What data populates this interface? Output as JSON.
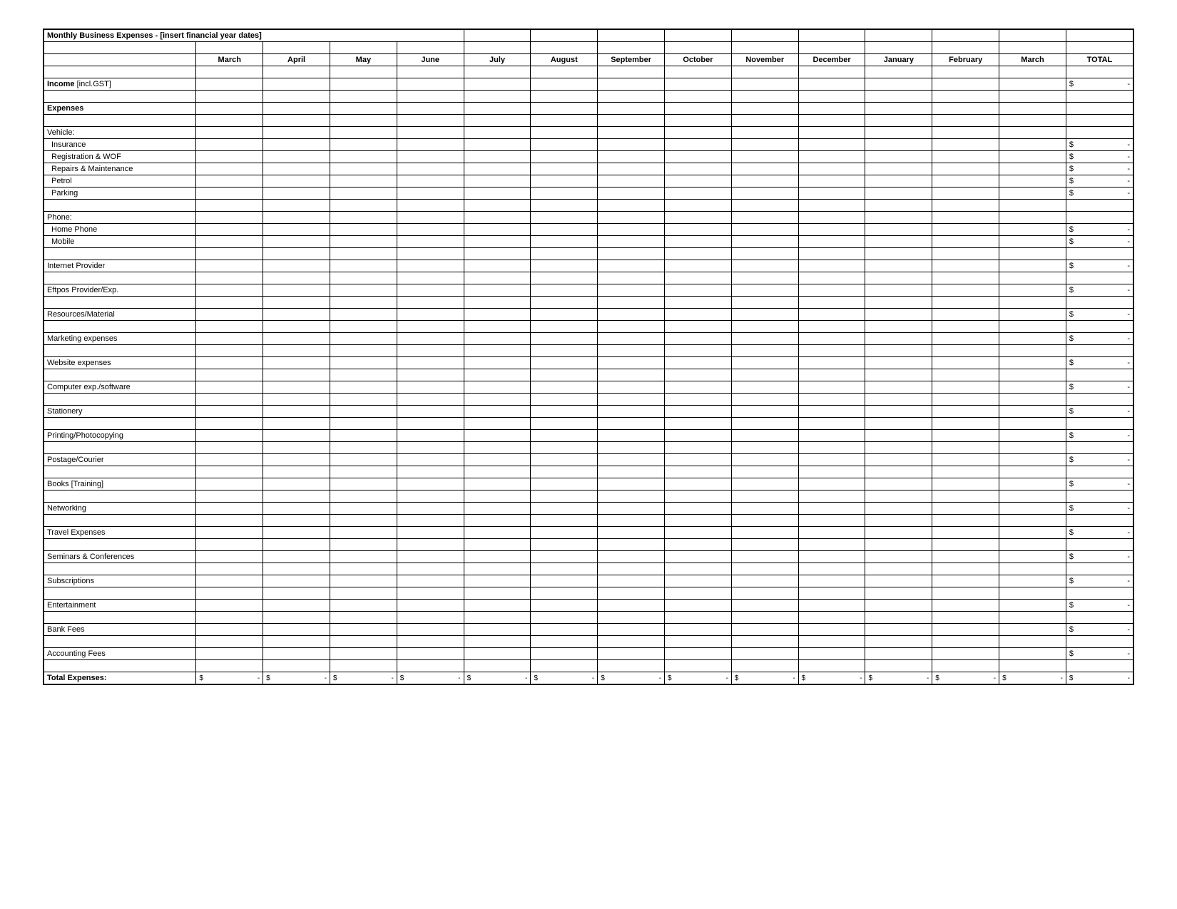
{
  "title": "Monthly Business Expenses - [insert financial year dates]",
  "months": [
    "March",
    "April",
    "May",
    "June",
    "July",
    "August",
    "September",
    "October",
    "November",
    "December",
    "January",
    "February",
    "March"
  ],
  "total_header": "TOTAL",
  "currency_symbol": "$",
  "empty_value": "-",
  "rows": [
    {
      "type": "blank"
    },
    {
      "type": "line",
      "label_bold": "Income",
      "label_rest": " [incl.GST]",
      "has_total": true
    },
    {
      "type": "blank"
    },
    {
      "type": "header",
      "label": "Expenses"
    },
    {
      "type": "blank"
    },
    {
      "type": "subheader",
      "label": "Vehicle:"
    },
    {
      "type": "sub",
      "label": "Insurance",
      "has_total": true
    },
    {
      "type": "sub",
      "label": "Registration & WOF",
      "has_total": true
    },
    {
      "type": "sub",
      "label": "Repairs & Maintenance",
      "has_total": true
    },
    {
      "type": "sub",
      "label": "Petrol",
      "has_total": true
    },
    {
      "type": "sub",
      "label": "Parking",
      "has_total": true
    },
    {
      "type": "blank"
    },
    {
      "type": "subheader",
      "label": "Phone:"
    },
    {
      "type": "sub",
      "label": "Home Phone",
      "has_total": true
    },
    {
      "type": "sub",
      "label": "Mobile",
      "has_total": true
    },
    {
      "type": "blank"
    },
    {
      "type": "item",
      "label": "Internet Provider",
      "has_total": true
    },
    {
      "type": "blank"
    },
    {
      "type": "item",
      "label": "Eftpos Provider/Exp.",
      "has_total": true
    },
    {
      "type": "blank"
    },
    {
      "type": "item",
      "label": "Resources/Material",
      "has_total": true
    },
    {
      "type": "blank"
    },
    {
      "type": "item",
      "label": "Marketing expenses",
      "has_total": true
    },
    {
      "type": "blank"
    },
    {
      "type": "item",
      "label": "Website expenses",
      "has_total": true
    },
    {
      "type": "blank"
    },
    {
      "type": "item",
      "label": "Computer exp./software",
      "has_total": true
    },
    {
      "type": "blank"
    },
    {
      "type": "item",
      "label": "Stationery",
      "has_total": true
    },
    {
      "type": "blank"
    },
    {
      "type": "item",
      "label": "Printing/Photocopying",
      "has_total": true
    },
    {
      "type": "blank"
    },
    {
      "type": "item",
      "label": "Postage/Courier",
      "has_total": true
    },
    {
      "type": "blank"
    },
    {
      "type": "item",
      "label": "Books [Training]",
      "has_total": true
    },
    {
      "type": "blank"
    },
    {
      "type": "item",
      "label": "Networking",
      "has_total": true
    },
    {
      "type": "blank"
    },
    {
      "type": "item",
      "label": "Travel Expenses",
      "has_total": true
    },
    {
      "type": "blank"
    },
    {
      "type": "item",
      "label": "Seminars & Conferences",
      "has_total": true
    },
    {
      "type": "blank"
    },
    {
      "type": "item",
      "label": "Subscriptions",
      "has_total": true
    },
    {
      "type": "blank"
    },
    {
      "type": "item",
      "label": "Entertainment",
      "has_total": true
    },
    {
      "type": "blank"
    },
    {
      "type": "item",
      "label": "Bank Fees",
      "has_total": true
    },
    {
      "type": "blank"
    },
    {
      "type": "item",
      "label": "Accounting Fees",
      "has_total": true
    },
    {
      "type": "blank"
    },
    {
      "type": "footer",
      "label": "Total Expenses:"
    }
  ]
}
